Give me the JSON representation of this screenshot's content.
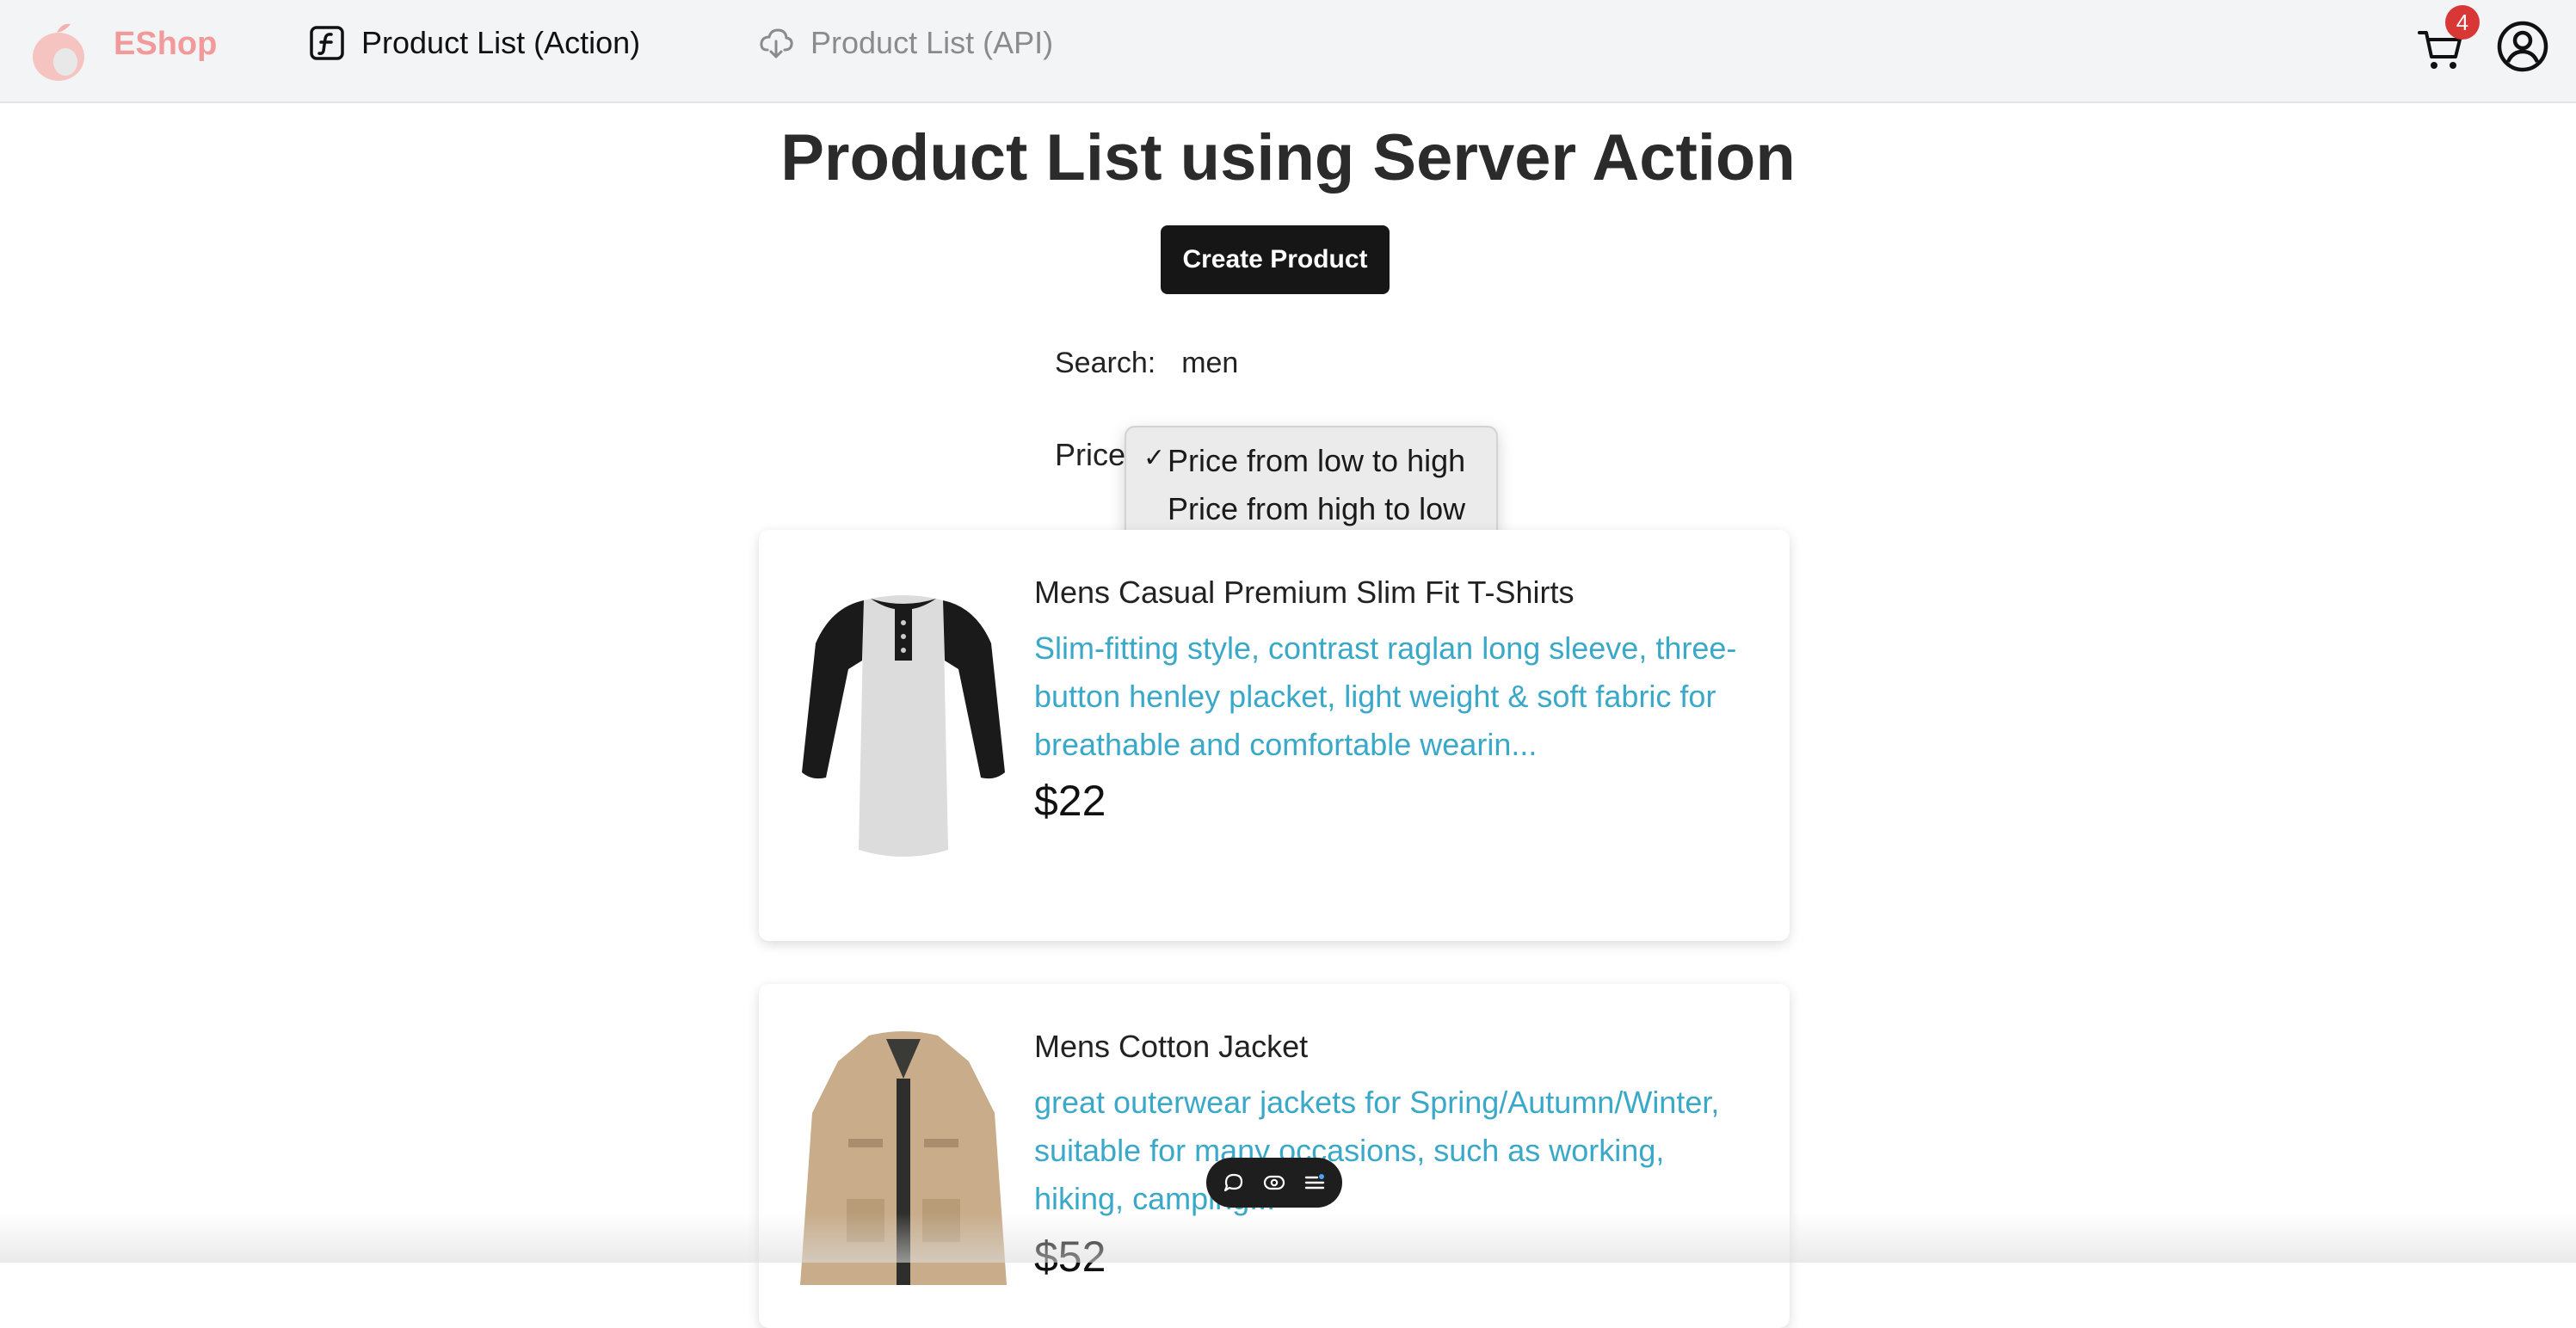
{
  "navbar": {
    "brand": "EShop",
    "links": [
      {
        "label": "Product List (Action)",
        "icon": "function-icon"
      },
      {
        "label": "Product List (API)",
        "icon": "cloud-download-icon"
      }
    ],
    "cart_count": "4",
    "colors": {
      "brand": "#f29a9a",
      "badge": "#d93636"
    }
  },
  "main": {
    "title": "Product List using Server Action",
    "create_button": "Create Product",
    "search_label": "Search:",
    "search_value": "men",
    "price_label": "Price",
    "sort_options": [
      {
        "label": "Price from low to high",
        "checked": "✓"
      },
      {
        "label": "Price from high to low",
        "checked": ""
      }
    ]
  },
  "products": [
    {
      "title": "Mens Casual Premium Slim Fit T-Shirts",
      "description": "Slim-fitting style, contrast raglan long sleeve, three-button henley placket, light weight & soft fabric for breathable and comfortable wearin...",
      "price": "$22"
    },
    {
      "title": "Mens Cotton Jacket",
      "description": "great outerwear jackets for Spring/Autumn/Winter, suitable for many occasions, such as working, hiking, camping...",
      "price": "$52"
    }
  ],
  "floating_toolbar": {
    "icons": [
      "comment-icon",
      "eye-icon",
      "list-icon"
    ]
  }
}
